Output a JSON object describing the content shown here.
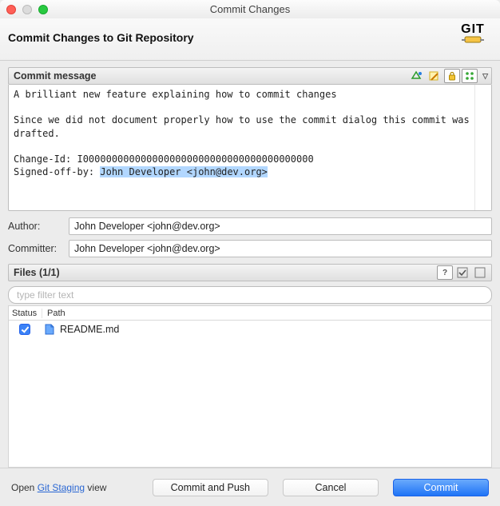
{
  "window": {
    "title": "Commit Changes"
  },
  "header": {
    "title": "Commit Changes to Git Repository",
    "logo_text": "GIT"
  },
  "commit_message": {
    "section_label": "Commit message",
    "line1": "A brilliant new feature explaining how to commit changes",
    "line2": "Since we did not document properly how to use the commit dialog this commit was drafted.",
    "change_id_line": "Change-Id: I0000000000000000000000000000000000000000",
    "signed_off_prefix": "Signed-off-by: ",
    "signed_off_value": "John Developer <john@dev.org>"
  },
  "author": {
    "label": "Author:",
    "value": "John Developer <john@dev.org>"
  },
  "committer": {
    "label": "Committer:",
    "value": "John Developer <john@dev.org>"
  },
  "files": {
    "section_label": "Files (1/1)",
    "filter_placeholder": "type filter text",
    "col_status": "Status",
    "col_path": "Path",
    "items": [
      {
        "checked": true,
        "path": "README.md"
      }
    ]
  },
  "footer": {
    "open_prefix": "Open ",
    "link_text": "Git Staging",
    "open_suffix": " view",
    "commit_push": "Commit and Push",
    "cancel": "Cancel",
    "commit": "Commit"
  }
}
